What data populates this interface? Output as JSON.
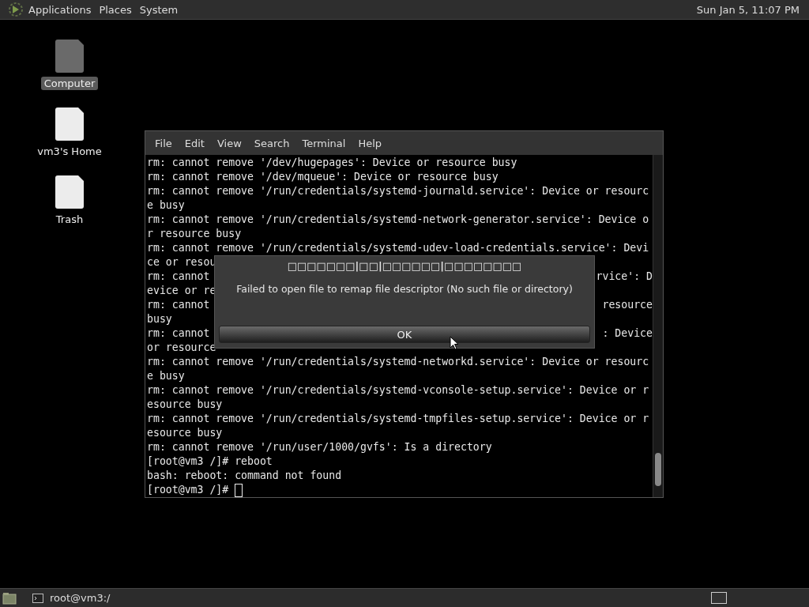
{
  "top_panel": {
    "menus": [
      "Applications",
      "Places",
      "System"
    ],
    "clock": "Sun Jan  5, 11:07 PM"
  },
  "desktop_icons": [
    {
      "label": "Computer",
      "kind": "computer",
      "selected": true
    },
    {
      "label": "vm3's Home",
      "kind": "folder",
      "selected": false
    },
    {
      "label": "Trash",
      "kind": "trash",
      "selected": false
    }
  ],
  "terminal": {
    "menus": [
      "File",
      "Edit",
      "View",
      "Search",
      "Terminal",
      "Help"
    ],
    "lines": [
      {
        "text": "rm: cannot remove '/dev/hugepages': Device or resource busy"
      },
      {
        "text": "rm: cannot remove '/dev/mqueue': Device or resource busy"
      },
      {
        "text": "rm: cannot remove '/run/credentials/systemd-journald.service': Device or resourc"
      },
      {
        "text": "e busy"
      },
      {
        "text": "rm: cannot remove '/run/credentials/systemd-network-generator.service': Device o"
      },
      {
        "text": "r resource busy"
      },
      {
        "text": "rm: cannot remove '/run/credentials/systemd-udev-load-credentials.service': Devi"
      },
      {
        "text": "ce or resou"
      },
      {
        "text": "rm: cannot",
        "right": "rvice': D"
      },
      {
        "text": "evice or re"
      },
      {
        "text": "rm: cannot",
        "right": "resource"
      },
      {
        "text": "busy"
      },
      {
        "text": "rm: cannot",
        "right": ": Device"
      },
      {
        "text": "or resource"
      },
      {
        "text": "rm: cannot remove '/run/credentials/systemd-networkd.service': Device or resourc"
      },
      {
        "text": "e busy"
      },
      {
        "text": "rm: cannot remove '/run/credentials/systemd-vconsole-setup.service': Device or r"
      },
      {
        "text": "esource busy"
      },
      {
        "text": "rm: cannot remove '/run/credentials/systemd-tmpfiles-setup.service': Device or r"
      },
      {
        "text": "esource busy"
      },
      {
        "text": "rm: cannot remove '/run/user/1000/gvfs': Is a directory"
      },
      {
        "text": "[root@vm3 /]# reboot"
      },
      {
        "text": "bash: reboot: command not found"
      },
      {
        "text": "[root@vm3 /]# ",
        "cursor": true
      }
    ]
  },
  "dialog": {
    "title": "□□□□□□□|□□|□□□□□□|□□□□□□□□",
    "message": "Failed to open file to remap file descriptor (No such file or directory)",
    "button": "OK"
  },
  "taskbar": {
    "tasks": [
      {
        "label": "root@vm3:/",
        "selected": false
      }
    ]
  }
}
